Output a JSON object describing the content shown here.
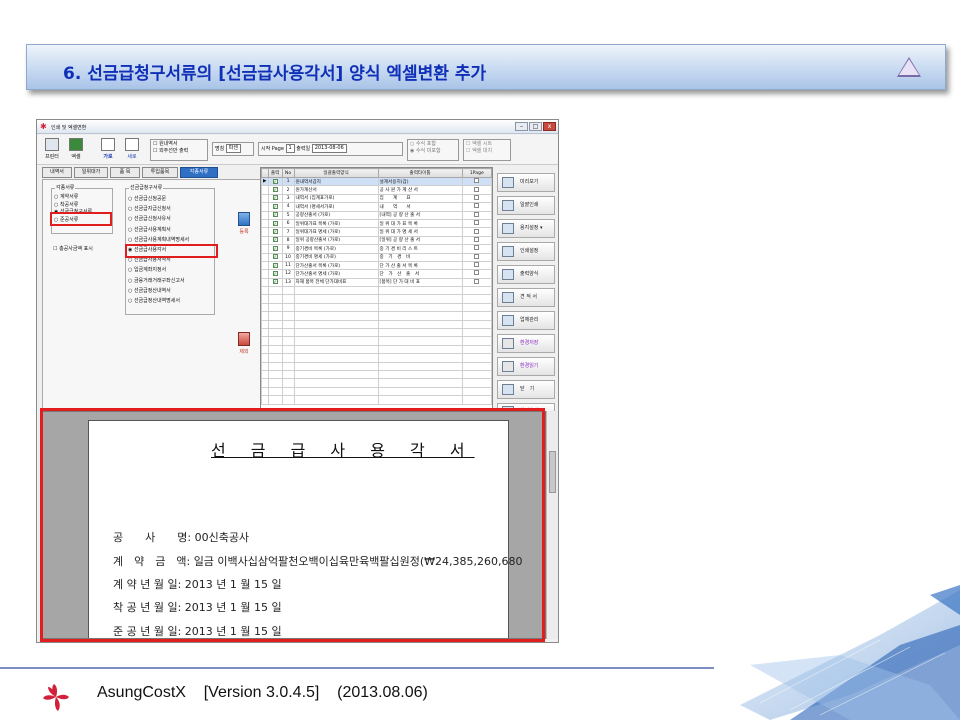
{
  "slide": {
    "title": "6. 선금급청구서류의 [선금급사용각서] 양식 엑셀변환 추가",
    "footer": {
      "product": "AsungCostX",
      "version": "[Version 3.0.4.5]",
      "date": "(2013.08.06)"
    }
  },
  "window": {
    "title": "인쇄 및 엑셀변환",
    "toolbar": {
      "print": "프린터",
      "excel": "엑셀",
      "landscape": "가로",
      "portrait": "세로",
      "opt1": "원내역서",
      "opt2": "외주선만 출력",
      "unit_label": "명칭",
      "unit_value": "파센",
      "start_page_label": "시작 Page",
      "start_page_value": "1",
      "print_date_label": "출력일",
      "print_date_value": "2013-08-06",
      "sum_opt1": "수식 포함",
      "sum_opt2": "수식 미포함",
      "excel_opt1": "엑셀 시트",
      "excel_opt2": "엑셀 대치"
    },
    "tabs": [
      "내역서",
      "일위대가",
      "품 목",
      "투입품목",
      "각종서류"
    ],
    "active_tab": "각종서류",
    "doc_types": {
      "caption": "각종서류",
      "items": [
        "계약서류",
        "착공서류",
        "선금급청구서류",
        "준공서류"
      ],
      "selected": "선금급청구서류",
      "checkbox": "총공사금액 표시"
    },
    "advance_docs": {
      "caption": "선금급청구서류",
      "items": [
        "선금급신청공문",
        "선금급지급신청서",
        "선금급신청사유서",
        "선금급사용계획서",
        "선금급사용계획내역명세서",
        "선금급사용각서",
        "선금급사용서약서",
        "입금계좌지정서",
        "금융거래거래구좌신고서",
        "선금급정산내역서",
        "선금급정산내역명세서"
      ],
      "selected": "선금급사용각서"
    },
    "mid_buttons": {
      "register": "등록",
      "remove": "제외"
    },
    "grid": {
      "headers": [
        "출력",
        "No",
        "일괄출력양식",
        "출력타이틀",
        "1Page"
      ],
      "rows": [
        [
          "1",
          "원내역서갑지",
          "설계서용지(갑)"
        ],
        [
          "2",
          "원가계산서",
          "공 사 원 가 계 산 서"
        ],
        [
          "3",
          "내역서 (집계표가로)",
          "집　　계　　표"
        ],
        [
          "4",
          "내역서 (명세서가로)",
          "내　　역　　서"
        ],
        [
          "5",
          "공량산출서 (가로)",
          "[내역] 공 량 산 출 서"
        ],
        [
          "6",
          "일위대가표 목록 (가로)",
          "일 위 대 가 표 목 록"
        ],
        [
          "7",
          "일위대가표 명세 (가로)",
          "일 위 대 가 명 세 서"
        ],
        [
          "8",
          "일위 공량산출서 (가로)",
          "[일위] 공 량 산 출 서"
        ],
        [
          "9",
          "중기경비 목록 (가로)",
          "중 기 경 비 리 스 트"
        ],
        [
          "10",
          "중기경비 명세 (가로)",
          "중　기　경　비"
        ],
        [
          "11",
          "단가산출서 목록 (가로)",
          "단 가 산 출 서 목 록"
        ],
        [
          "12",
          "단가산출서 명세 (가로)",
          "단　가　산　출　서"
        ],
        [
          "13",
          "자재 품목 전체 단가대비표",
          "[품목] 단 가 대 비 표"
        ]
      ]
    },
    "side_buttons": [
      "미리보기",
      "일괄인쇄",
      "용지설정",
      "인쇄설정",
      "출력양식",
      "견 적 서",
      "업체관리",
      "환경저장",
      "환경읽기",
      "닫　기",
      "화면숨김"
    ],
    "preview": {
      "title": "선 금 급 사 용 각 서",
      "lines": [
        {
          "label": "공　　사　　명:",
          "value": "00신축공사"
        },
        {
          "label": "계　약　금　액:",
          "value": "일금 이백사십삼억팔천오백이십육만육백팔십원정(₩24,385,260,680"
        },
        {
          "label": "계 약 년 월 일:",
          "value": "2013 년 1 월 15 일"
        },
        {
          "label": "착 공 년 월 일:",
          "value": "2013 년 1 월 15 일"
        },
        {
          "label": "준 공 년 월 일:",
          "value": "2013 년 1 월 15 일"
        }
      ]
    }
  },
  "colors": {
    "title_blue": "#0f2fb8",
    "highlight_red": "#e21d1d"
  }
}
